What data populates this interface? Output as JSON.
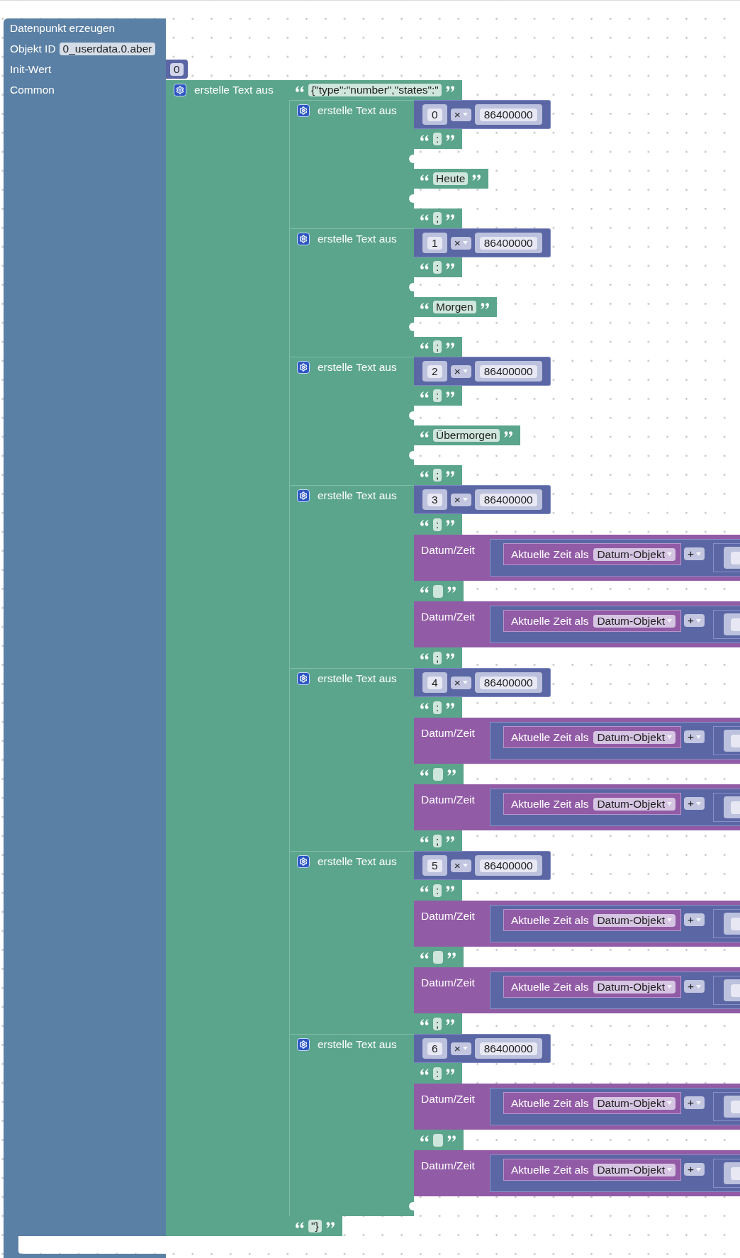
{
  "workspace": {
    "block": {
      "title": "Datenpunkt erzeugen",
      "object_id": {
        "label": "Objekt ID",
        "value": "0_userdata.0.aber"
      },
      "init_value": {
        "label": "Init-Wert",
        "value": "0"
      },
      "common": {
        "label": "Common",
        "block": {
          "kind": "join",
          "label": "erstelle Text aus",
          "items": [
            {
              "kind": "text",
              "value": "{\"type\":\"number\",\"states\":\""
            },
            {
              "kind": "join",
              "label": "erstelle Text aus",
              "items": [
                {
                  "kind": "multiply",
                  "a": "0",
                  "op": "×",
                  "b": "86400000"
                },
                {
                  "kind": "text",
                  "value": ":"
                },
                {
                  "kind": "empty"
                },
                {
                  "kind": "text",
                  "value": "Heute"
                },
                {
                  "kind": "empty"
                },
                {
                  "kind": "text",
                  "value": ";"
                }
              ]
            },
            {
              "kind": "join",
              "label": "erstelle Text aus",
              "items": [
                {
                  "kind": "multiply",
                  "a": "1",
                  "op": "×",
                  "b": "86400000"
                },
                {
                  "kind": "text",
                  "value": ":"
                },
                {
                  "kind": "empty"
                },
                {
                  "kind": "text",
                  "value": "Morgen"
                },
                {
                  "kind": "empty"
                },
                {
                  "kind": "text",
                  "value": ";"
                }
              ]
            },
            {
              "kind": "join",
              "label": "erstelle Text aus",
              "items": [
                {
                  "kind": "multiply",
                  "a": "2",
                  "op": "×",
                  "b": "86400000"
                },
                {
                  "kind": "text",
                  "value": ":"
                },
                {
                  "kind": "empty"
                },
                {
                  "kind": "text",
                  "value": "Übermorgen"
                },
                {
                  "kind": "empty"
                },
                {
                  "kind": "text",
                  "value": ";"
                }
              ]
            },
            {
              "kind": "join",
              "label": "erstelle Text aus",
              "items": [
                {
                  "kind": "multiply",
                  "a": "3",
                  "op": "×",
                  "b": "86400000"
                },
                {
                  "kind": "text",
                  "value": ":"
                },
                {
                  "kind": "datetime",
                  "label": "Datum/Zeit",
                  "source": "Aktuelle Zeit als",
                  "format": "Datum-Objekt",
                  "op": "+"
                },
                {
                  "kind": "blank_text"
                },
                {
                  "kind": "datetime",
                  "label": "Datum/Zeit",
                  "source": "Aktuelle Zeit als",
                  "format": "Datum-Objekt",
                  "op": "+"
                },
                {
                  "kind": "text",
                  "value": ";"
                }
              ]
            },
            {
              "kind": "join",
              "label": "erstelle Text aus",
              "items": [
                {
                  "kind": "multiply",
                  "a": "4",
                  "op": "×",
                  "b": "86400000"
                },
                {
                  "kind": "text",
                  "value": ":"
                },
                {
                  "kind": "datetime",
                  "label": "Datum/Zeit",
                  "source": "Aktuelle Zeit als",
                  "format": "Datum-Objekt",
                  "op": "+"
                },
                {
                  "kind": "blank_text"
                },
                {
                  "kind": "datetime",
                  "label": "Datum/Zeit",
                  "source": "Aktuelle Zeit als",
                  "format": "Datum-Objekt",
                  "op": "+"
                },
                {
                  "kind": "text",
                  "value": ";"
                }
              ]
            },
            {
              "kind": "join",
              "label": "erstelle Text aus",
              "items": [
                {
                  "kind": "multiply",
                  "a": "5",
                  "op": "×",
                  "b": "86400000"
                },
                {
                  "kind": "text",
                  "value": ":"
                },
                {
                  "kind": "datetime",
                  "label": "Datum/Zeit",
                  "source": "Aktuelle Zeit als",
                  "format": "Datum-Objekt",
                  "op": "+"
                },
                {
                  "kind": "blank_text"
                },
                {
                  "kind": "datetime",
                  "label": "Datum/Zeit",
                  "source": "Aktuelle Zeit als",
                  "format": "Datum-Objekt",
                  "op": "+"
                },
                {
                  "kind": "text",
                  "value": ";"
                }
              ]
            },
            {
              "kind": "join",
              "label": "erstelle Text aus",
              "items": [
                {
                  "kind": "multiply",
                  "a": "6",
                  "op": "×",
                  "b": "86400000"
                },
                {
                  "kind": "text",
                  "value": ":"
                },
                {
                  "kind": "datetime",
                  "label": "Datum/Zeit",
                  "source": "Aktuelle Zeit als",
                  "format": "Datum-Objekt",
                  "op": "+"
                },
                {
                  "kind": "blank_text"
                },
                {
                  "kind": "datetime",
                  "label": "Datum/Zeit",
                  "source": "Aktuelle Zeit als",
                  "format": "Datum-Objekt",
                  "op": "+"
                },
                {
                  "kind": "empty"
                }
              ]
            },
            {
              "kind": "text",
              "value": "\"}"
            }
          ]
        }
      }
    }
  }
}
